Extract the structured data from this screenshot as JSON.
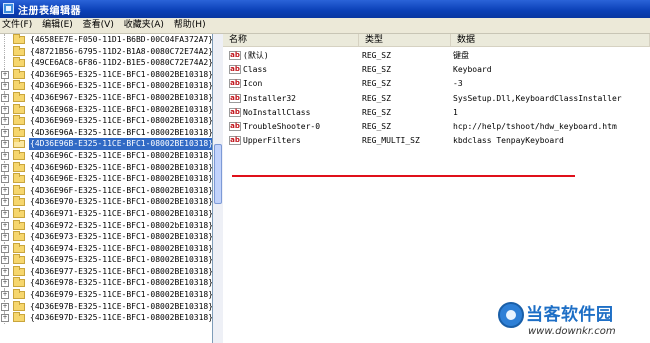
{
  "window": {
    "title": "注册表编辑器"
  },
  "menu": [
    {
      "label": "文件(F)"
    },
    {
      "label": "编辑(E)"
    },
    {
      "label": "查看(V)"
    },
    {
      "label": "收藏夹(A)"
    },
    {
      "label": "帮助(H)"
    }
  ],
  "tree": {
    "items": [
      {
        "label": "{4658EE7E-F050-11D1-B6BD-00C04FA372A7}",
        "expander": "",
        "selected": false
      },
      {
        "label": "{48721B56-6795-11D2-B1A8-0080C72E74A2}",
        "expander": "",
        "selected": false
      },
      {
        "label": "{49CE6AC8-6F86-11D2-B1E5-0080C72E74A2}",
        "expander": "",
        "selected": false
      },
      {
        "label": "{4D36E965-E325-11CE-BFC1-08002BE10318}",
        "expander": "+",
        "selected": false
      },
      {
        "label": "{4D36E966-E325-11CE-BFC1-08002BE10318}",
        "expander": "+",
        "selected": false
      },
      {
        "label": "{4D36E967-E325-11CE-BFC1-08002BE10318}",
        "expander": "+",
        "selected": false
      },
      {
        "label": "{4D36E968-E325-11CE-BFC1-08002BE10318}",
        "expander": "+",
        "selected": false
      },
      {
        "label": "{4D36E969-E325-11CE-BFC1-08002BE10318}",
        "expander": "+",
        "selected": false
      },
      {
        "label": "{4D36E96A-E325-11CE-BFC1-08002BE10318}",
        "expander": "+",
        "selected": false
      },
      {
        "label": "{4D36E96B-E325-11CE-BFC1-08002BE10318}",
        "expander": "+",
        "selected": true
      },
      {
        "label": "{4D36E96C-E325-11CE-BFC1-08002BE10318}",
        "expander": "+",
        "selected": false
      },
      {
        "label": "{4D36E96D-E325-11CE-BFC1-08002BE10318}",
        "expander": "+",
        "selected": false
      },
      {
        "label": "{4D36E96E-E325-11CE-BFC1-08002BE10318}",
        "expander": "+",
        "selected": false
      },
      {
        "label": "{4D36E96F-E325-11CE-BFC1-08002BE10318}",
        "expander": "+",
        "selected": false
      },
      {
        "label": "{4D36E970-E325-11CE-BFC1-08002BE10318}",
        "expander": "+",
        "selected": false
      },
      {
        "label": "{4D36E971-E325-11CE-BFC1-08002BE10318}",
        "expander": "+",
        "selected": false
      },
      {
        "label": "{4D36E972-E325-11CE-BFC1-08002bE10318}",
        "expander": "+",
        "selected": false
      },
      {
        "label": "{4D36E973-E325-11CE-BFC1-08002BE10318}",
        "expander": "+",
        "selected": false
      },
      {
        "label": "{4D36E974-E325-11CE-BFC1-08002BE10318}",
        "expander": "+",
        "selected": false
      },
      {
        "label": "{4D36E975-E325-11CE-BFC1-08002BE10318}",
        "expander": "+",
        "selected": false
      },
      {
        "label": "{4D36E977-E325-11CE-BFC1-08002BE10318}",
        "expander": "+",
        "selected": false
      },
      {
        "label": "{4D36E978-E325-11CE-BFC1-08002BE10318}",
        "expander": "+",
        "selected": false
      },
      {
        "label": "{4D36E979-E325-11CE-BFC1-08002BE10318}",
        "expander": "+",
        "selected": false
      },
      {
        "label": "{4D36E97B-E325-11CE-BFC1-08002BE10318}",
        "expander": "+",
        "selected": false
      },
      {
        "label": "{4D36E97D-E325-11CE-BFC1-08002BE10318}",
        "expander": "+",
        "selected": false
      }
    ]
  },
  "values": {
    "headers": {
      "name": "名称",
      "type": "类型",
      "data": "数据"
    },
    "rows": [
      {
        "name": "(默认)",
        "type": "REG_SZ",
        "data": "键盘"
      },
      {
        "name": "Class",
        "type": "REG_SZ",
        "data": "Keyboard"
      },
      {
        "name": "Icon",
        "type": "REG_SZ",
        "data": "-3"
      },
      {
        "name": "Installer32",
        "type": "REG_SZ",
        "data": "SysSetup.Dll,KeyboardClassInstaller"
      },
      {
        "name": "NoInstallClass",
        "type": "REG_SZ",
        "data": "1"
      },
      {
        "name": "TroubleShooter-0",
        "type": "REG_SZ",
        "data": "hcp://help/tshoot/hdw_keyboard.htm"
      },
      {
        "name": "UpperFilters",
        "type": "REG_MULTI_SZ",
        "data": "kbdclass TenpayKeyboard"
      }
    ],
    "value_icon_text": "ab"
  },
  "watermark": {
    "title": "当客软件园",
    "url": "www.downkr.com"
  },
  "colors": {
    "selection": "#316ac5",
    "highlight_line": "#e0101a",
    "titlebar": "#0a3fb6"
  }
}
